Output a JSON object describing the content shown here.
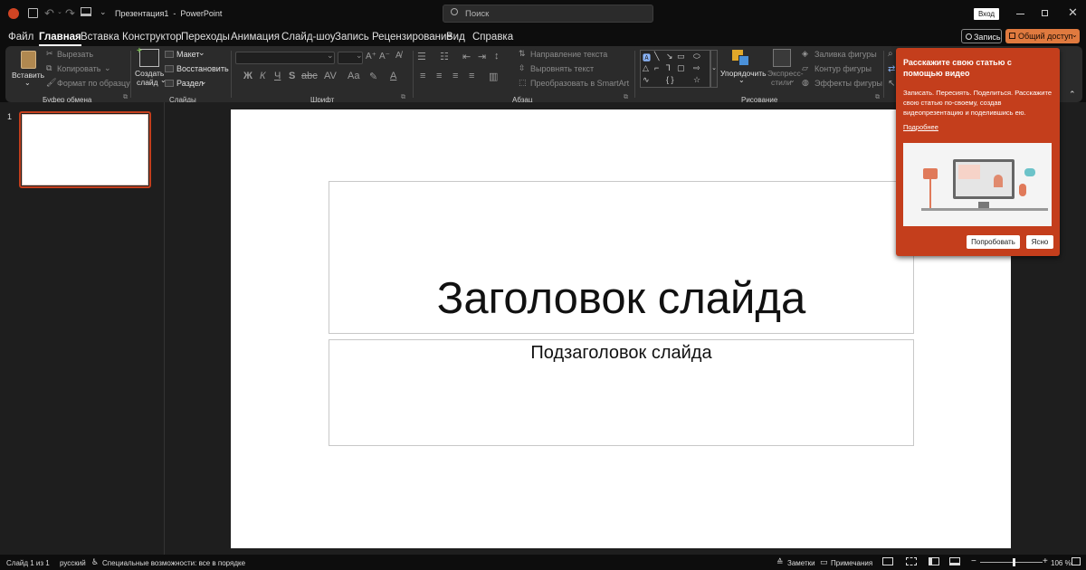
{
  "titlebar": {
    "doc_title": "Презентация1  -  PowerPoint",
    "search_placeholder": "Поиск",
    "signin_label": "Вход"
  },
  "tabs": [
    "Файл",
    "Главная",
    "Вставка",
    "Конструктор",
    "Переходы",
    "Анимация",
    "Слайд-шоу",
    "Запись",
    "Рецензирование",
    "Вид",
    "Справка"
  ],
  "record_button": "Запись",
  "share_button": "Общий доступ",
  "ribbon": {
    "clipboard": {
      "paste": "Вставить",
      "cut": "Вырезать",
      "copy": "Копировать",
      "format_painter": "Формат по образцу",
      "group": "Буфер обмена"
    },
    "slides": {
      "new_slide_line1": "Создать",
      "new_slide_line2": "слайд",
      "layout": "Макет",
      "reset": "Восстановить",
      "section": "Раздел",
      "group": "Слайды"
    },
    "font": {
      "group": "Шрифт"
    },
    "paragraph": {
      "text_direction": "Направление текста",
      "align_text": "Выровнять текст",
      "smartart": "Преобразовать в SmartArt",
      "group": "Абзац"
    },
    "drawing": {
      "arrange": "Упорядочить",
      "quick_styles_line1": "Экспресс-",
      "quick_styles_line2": "стили",
      "shape_fill": "Заливка фигуры",
      "shape_outline": "Контур фигуры",
      "shape_effects": "Эффекты фигуры",
      "group": "Рисование"
    }
  },
  "thumbnail": {
    "number": "1"
  },
  "slide": {
    "title": "Заголовок слайда",
    "subtitle": "Подзаголовок слайда"
  },
  "popup": {
    "title": "Расскажите свою статью с помощью видео",
    "body": "Записать. Пересиять. Поделиться. Расскажите свою статью по-своему, создав видеопрезентацию и поделившись ею.",
    "link": "Подробнее",
    "try_button": "Попробовать",
    "ok_button": "Ясно"
  },
  "statusbar": {
    "slide_count": "Слайд 1 из 1",
    "language": "русский",
    "accessibility": "Специальные возможности: все в порядке",
    "notes": "Заметки",
    "comments": "Примечания",
    "zoom": "106 %"
  },
  "colors": {
    "accent": "#c43e1c",
    "share": "#e07a3f",
    "ribbon_bg": "#2b2b2b",
    "window_bg": "#0d0d0d"
  }
}
